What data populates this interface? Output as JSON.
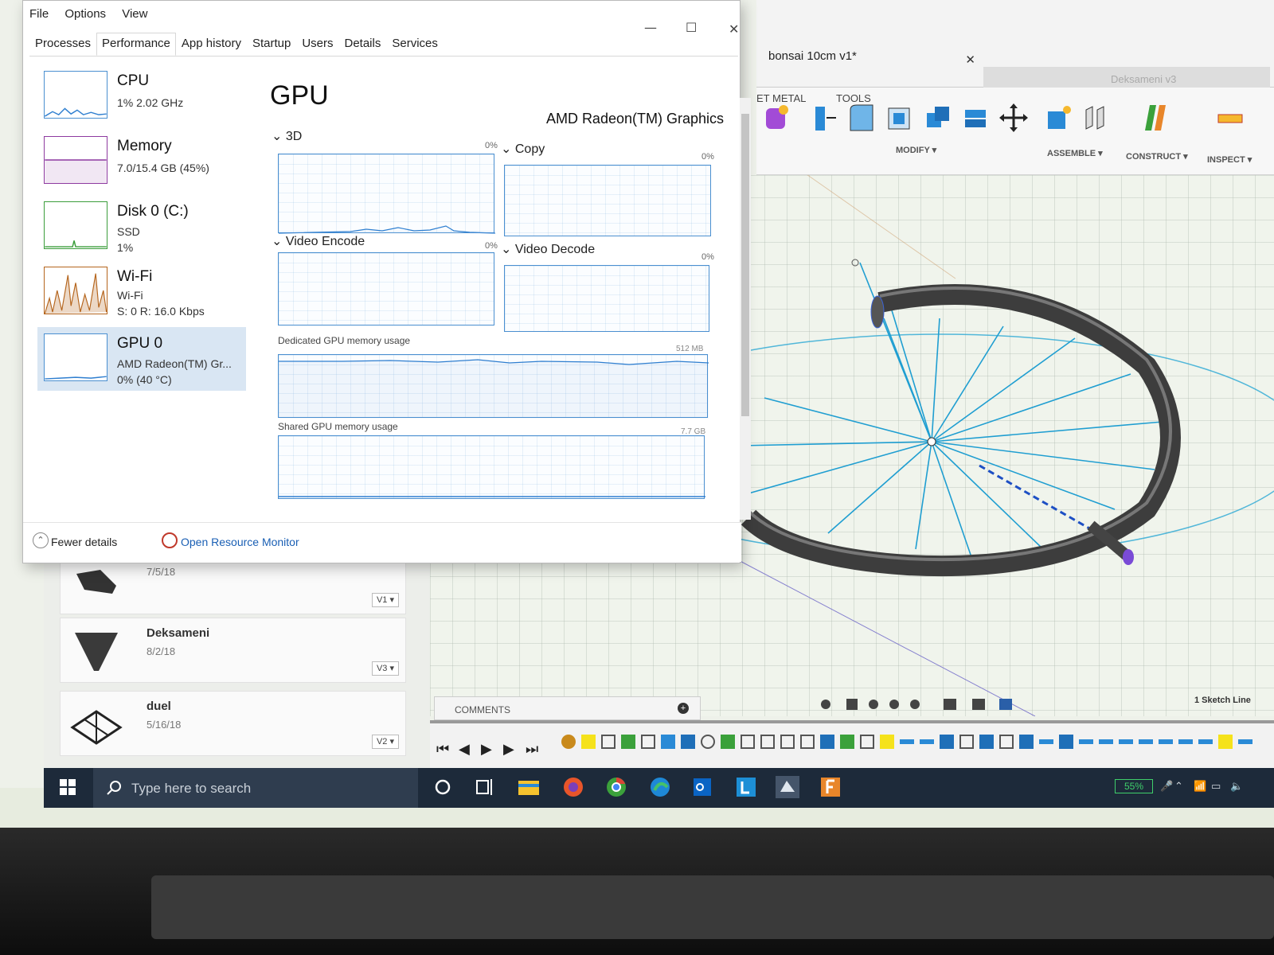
{
  "task_manager": {
    "menu": [
      "File",
      "Options",
      "View"
    ],
    "tabs": [
      "Processes",
      "Performance",
      "App history",
      "Startup",
      "Users",
      "Details",
      "Services"
    ],
    "active_tab": "Performance",
    "resources": [
      {
        "name": "CPU",
        "line1": "1% 2.02 GHz",
        "line2": "",
        "line3": "",
        "color": "#2f7fd0"
      },
      {
        "name": "Memory",
        "line1": "7.0/15.4 GB (45%)",
        "line2": "",
        "line3": "",
        "color": "#8e3aa0"
      },
      {
        "name": "Disk 0 (C:)",
        "line1": "SSD",
        "line2": "1%",
        "line3": "",
        "color": "#3b9d3b"
      },
      {
        "name": "Wi-Fi",
        "line1": "Wi-Fi",
        "line2": "S: 0 R: 16.0 Kbps",
        "line3": "",
        "color": "#b5651d"
      },
      {
        "name": "GPU 0",
        "line1": "AMD Radeon(TM) Gr...",
        "line2": "0% (40 °C)",
        "line3": "",
        "color": "#2f7fd0"
      }
    ],
    "gpu_panel": {
      "title": "GPU",
      "device": "AMD Radeon(TM) Graphics",
      "graphs": [
        {
          "label": "3D",
          "pct": "0%"
        },
        {
          "label": "Copy",
          "pct": "0%"
        },
        {
          "label": "Video Encode",
          "pct": "0%"
        },
        {
          "label": "Video Decode",
          "pct": "0%"
        }
      ],
      "dedicated_label": "Dedicated GPU memory usage",
      "dedicated_max": "512 MB",
      "shared_label": "Shared GPU memory usage",
      "shared_max": "7.7 GB"
    },
    "footer": {
      "fewer_details": "Fewer details",
      "open_monitor": "Open Resource Monitor"
    }
  },
  "fusion": {
    "doc_tab": "bonsai 10cm v1*",
    "doc_tab2": "Deksameni v3",
    "ribbon_tabs": [
      "ET METAL",
      "TOOLS"
    ],
    "ribbon_groups": [
      "MODIFY ▾",
      "ASSEMBLE ▾",
      "CONSTRUCT ▾",
      "INSPECT ▾"
    ],
    "data_items": [
      {
        "name": "",
        "date": "7/5/18",
        "version": "V1 ▾"
      },
      {
        "name": "Deksameni",
        "date": "8/2/18",
        "version": "V3 ▾"
      },
      {
        "name": "duel",
        "date": "5/16/18",
        "version": "V2 ▾"
      }
    ],
    "comments_label": "COMMENTS",
    "status": "1 Sketch Line"
  },
  "taskbar": {
    "search_placeholder": "Type here to search",
    "battery": "55%",
    "apps": [
      "cortana-icon",
      "task-view-icon",
      "file-explorer-icon",
      "firefox-icon",
      "chrome-icon",
      "edge-icon",
      "outlook-icon",
      "l-app-icon",
      "fusion360-icon",
      "f-app-icon"
    ]
  }
}
